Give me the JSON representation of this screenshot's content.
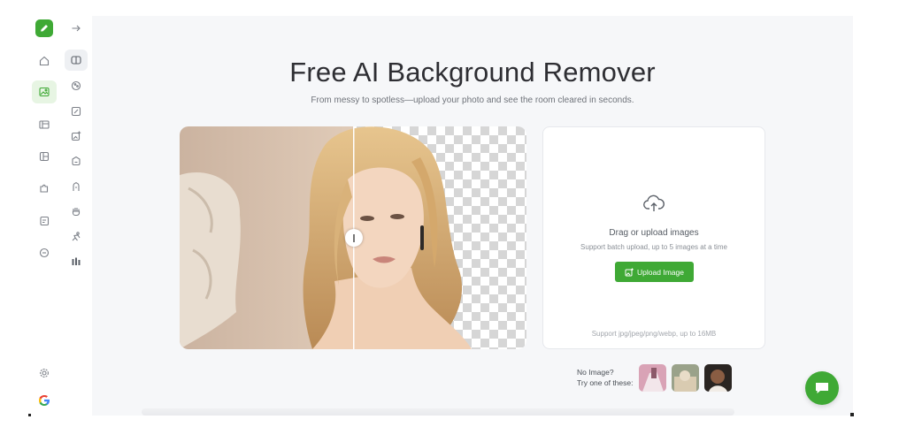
{
  "hero": {
    "title": "Free AI Background Remover",
    "subtitle": "From messy to spotless—upload your photo and see the room cleared in seconds."
  },
  "upload": {
    "drag_text": "Drag or upload images",
    "batch_text": "Support batch upload, up to 5 images at a time",
    "button_label": "Upload Image",
    "formats_text": "Support jpg/jpeg/png/webp, up to 16MB"
  },
  "samples": {
    "line1": "No Image?",
    "line2": "Try one of these:"
  },
  "sidebar": {
    "items": [
      "home-icon",
      "image-icon",
      "layout-icon",
      "panels-icon",
      "puzzle-icon",
      "note-icon",
      "chat-bubble-icon"
    ],
    "bottom": [
      "settings-icon",
      "google-icon"
    ]
  },
  "tools": {
    "items": [
      "compare-icon",
      "palette-icon",
      "edit-image-icon",
      "add-image-icon",
      "face-icon",
      "person-icon",
      "hand-icon",
      "pose-icon",
      "chart-icon"
    ]
  },
  "colors": {
    "accent": "#3fa935",
    "background": "#f6f7f9"
  }
}
